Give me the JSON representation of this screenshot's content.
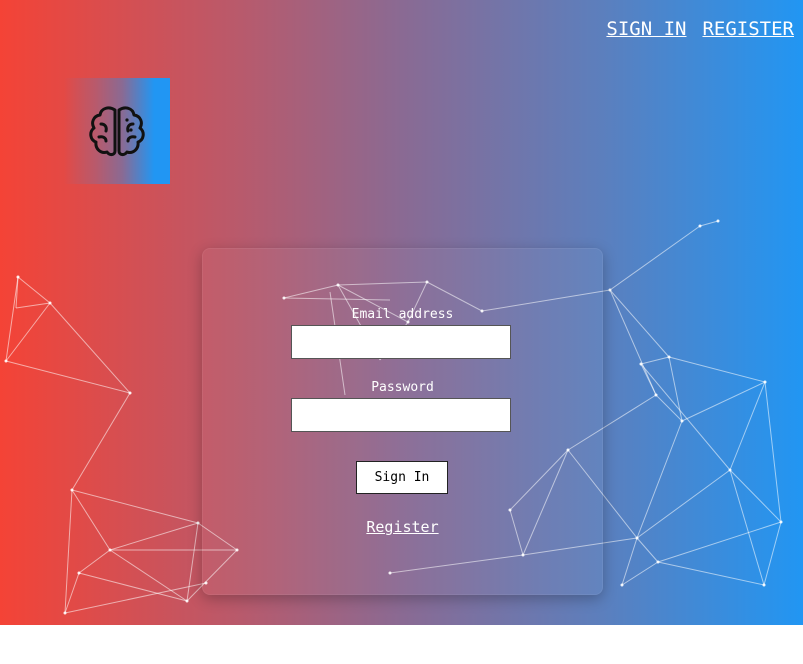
{
  "nav": {
    "sign_in": "SIGN IN",
    "register": "REGISTER"
  },
  "logo": {
    "icon": "brain-icon"
  },
  "form": {
    "email_label": "Email address",
    "email_value": "",
    "password_label": "Password",
    "password_value": "",
    "submit_label": "Sign In",
    "register_link": "Register"
  },
  "colors": {
    "gradient_start": "#f44336",
    "gradient_end": "#2196f3",
    "text": "#ffffff"
  }
}
